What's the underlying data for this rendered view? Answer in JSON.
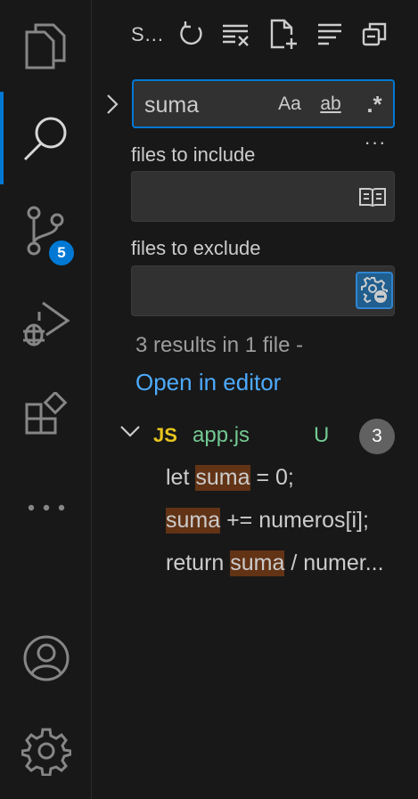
{
  "activity_bar": {
    "items": [
      {
        "name": "explorer",
        "icon": "files-icon"
      },
      {
        "name": "search",
        "icon": "search-icon",
        "active": true
      },
      {
        "name": "source-control",
        "icon": "source-control-icon",
        "badge": "5"
      },
      {
        "name": "run-debug",
        "icon": "run-debug-icon"
      },
      {
        "name": "extensions",
        "icon": "extensions-icon"
      },
      {
        "name": "more",
        "icon": "ellipsis-icon"
      }
    ],
    "bottom": [
      {
        "name": "accounts",
        "icon": "account-icon"
      },
      {
        "name": "manage",
        "icon": "gear-icon"
      }
    ],
    "accent": "#0078d4"
  },
  "panel": {
    "title": "S...",
    "toolbar_icons": [
      "refresh-icon",
      "clear-results-icon",
      "new-search-editor-icon",
      "view-as-tree-icon",
      "collapse-all-icon"
    ]
  },
  "search": {
    "value": "suma",
    "match_case": "Aa",
    "match_whole_word": "ab",
    "use_regex": ".*",
    "more": "···"
  },
  "include": {
    "label": "files to include",
    "value": ""
  },
  "exclude": {
    "label": "files to exclude",
    "value": ""
  },
  "results": {
    "message": "3 results in 1 file -",
    "open_in_editor": "Open in editor",
    "file": {
      "icon_text": "JS",
      "name": "app.js",
      "status": "U",
      "count": "3"
    },
    "matches": [
      {
        "before": "let ",
        "match": "suma",
        "after": " = 0;"
      },
      {
        "before": "",
        "match": "suma",
        "after": " += numeros[i];"
      },
      {
        "before": "return ",
        "match": "suma",
        "after": " / numer..."
      }
    ]
  },
  "colors": {
    "background": "#181818",
    "highlight": "#623315",
    "link": "#4daafc",
    "untracked": "#73c991",
    "js": "#e8c51f"
  }
}
